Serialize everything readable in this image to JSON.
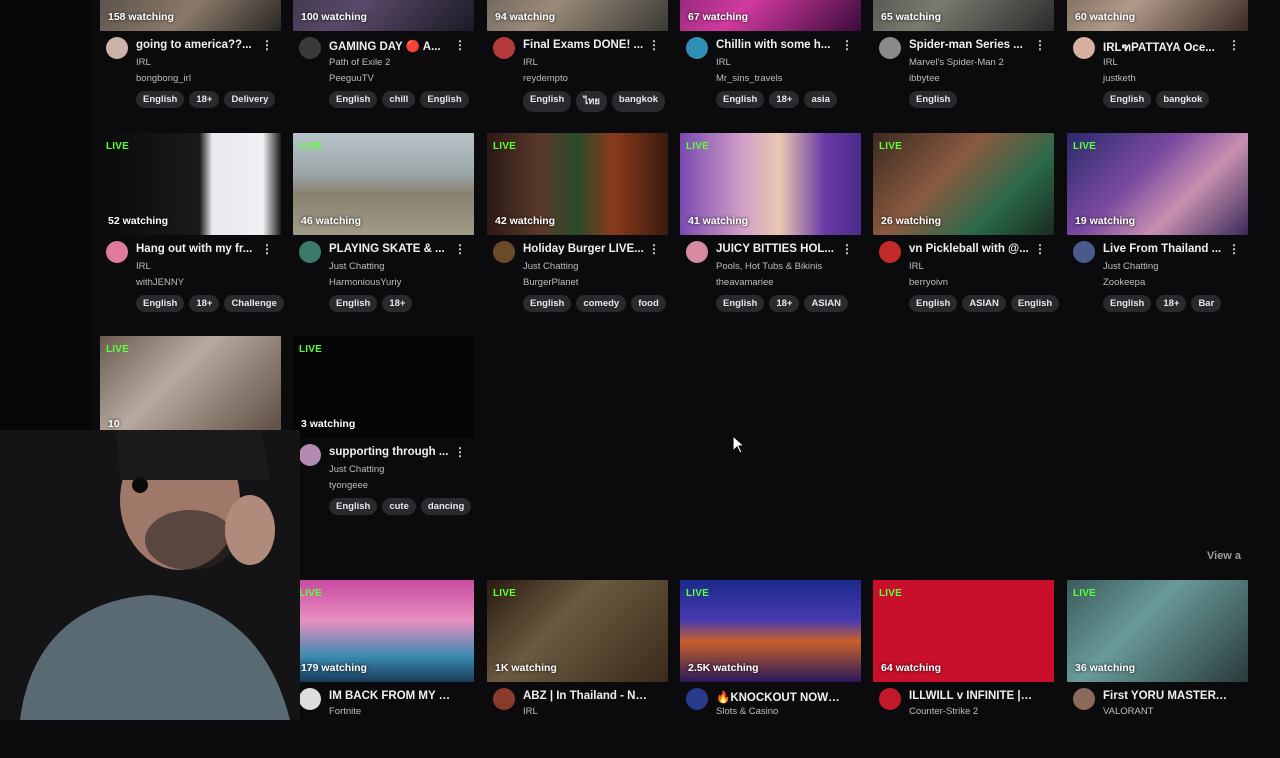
{
  "view_all_label": "View a",
  "streams_row1": [
    {
      "viewers": "158 watching",
      "title": "going to america??...",
      "category": "IRL",
      "channel": "bongbong_irl",
      "tags": [
        "English",
        "18+",
        "Delivery"
      ],
      "avatar_color": "#c9b2a8"
    },
    {
      "viewers": "100 watching",
      "title": "GAMING DAY 🔴 A...",
      "category": "Path of Exile 2",
      "channel": "PeeguuTV",
      "tags": [
        "English",
        "chill",
        "English"
      ],
      "avatar_color": "#2b2b2b"
    },
    {
      "viewers": "94 watching",
      "title": "Final Exams DONE! ...",
      "category": "IRL",
      "channel": "reydempto",
      "tags": [
        "English",
        "ไทย",
        "bangkok"
      ],
      "avatar_color": "#b33a3a"
    },
    {
      "viewers": "67 watching",
      "title": "Chillin with some h...",
      "category": "IRL",
      "channel": "Mr_sins_travels",
      "tags": [
        "English",
        "18+",
        "asia"
      ],
      "avatar_color": "#2f8fb5"
    },
    {
      "viewers": "65 watching",
      "title": "Spider-man Series ...",
      "category": "Marvel's Spider-Man 2",
      "channel": "ibbytee",
      "tags": [
        "English"
      ],
      "avatar_color": "#8a8a8a"
    },
    {
      "viewers": "60 watching",
      "title": "IRLฑPATTAYA Oce...",
      "category": "IRL",
      "channel": "justketh",
      "tags": [
        "English",
        "bangkok"
      ],
      "avatar_color": "#d8b0a0"
    }
  ],
  "streams_row2": [
    {
      "live": "LIVE",
      "viewers": "52 watching",
      "title": "Hang out with my fr...",
      "category": "IRL",
      "channel": "withJENNY",
      "tags": [
        "English",
        "18+",
        "Challenge"
      ],
      "avatar_color": "#e07a9c"
    },
    {
      "live": "LIVE",
      "viewers": "46 watching",
      "title": "PLAYING SKATE & ...",
      "category": "Just Chatting",
      "channel": "HarmoniousYuriy",
      "tags": [
        "English",
        "18+"
      ],
      "avatar_color": "#3a7a6a"
    },
    {
      "live": "LIVE",
      "viewers": "42 watching",
      "title": "Holiday Burger LIVE...",
      "category": "Just Chatting",
      "channel": "BurgerPlanet",
      "tags": [
        "English",
        "comedy",
        "food"
      ],
      "avatar_color": "#6b4a2a"
    },
    {
      "live": "LIVE",
      "viewers": "41 watching",
      "title": "JUICY BITTIES HOL...",
      "category": "Pools, Hot Tubs & Bikinis",
      "channel": "theavamariee",
      "tags": [
        "English",
        "18+",
        "ASIAN"
      ],
      "avatar_color": "#d58aa0"
    },
    {
      "live": "LIVE",
      "viewers": "26 watching",
      "title": "vn Pickleball with @...",
      "category": "IRL",
      "channel": "berryoivn",
      "tags": [
        "English",
        "ASIAN",
        "English"
      ],
      "avatar_color": "#c22a2a"
    },
    {
      "live": "LIVE",
      "viewers": "19 watching",
      "title": "Live From Thailand ...",
      "category": "Just Chatting",
      "channel": "Zookeepa",
      "tags": [
        "English",
        "18+",
        "Bar"
      ],
      "avatar_color": "#4a5a8a"
    }
  ],
  "streams_row3": [
    {
      "live": "LIVE",
      "viewers": "10",
      "title": "",
      "category": "",
      "channel": "",
      "tags": [],
      "avatar_color": "#888"
    },
    {
      "live": "LIVE",
      "viewers": "3 watching",
      "title": "supporting through ...",
      "category": "Just Chatting",
      "channel": "tyongeee",
      "tags": [
        "English",
        "cute",
        "dancing"
      ],
      "avatar_color": "#b58ab0"
    }
  ],
  "streams_row4": [
    {
      "live": "LIVE",
      "viewers": "179 watching",
      "title": "IM BACK FROM MY BIR...",
      "category": "Fortnite",
      "avatar_color": "#ddd"
    },
    {
      "live": "LIVE",
      "viewers": "1K watching",
      "title": "ABZ | In Thailand - Not ...",
      "category": "IRL",
      "avatar_color": "#8a3a2a"
    },
    {
      "live": "LIVE",
      "viewers": "2.5K watching",
      "title": "🔥KNOCKOUT NOW!🔥...",
      "category": "Slots & Casino",
      "avatar_color": "#2a3a8a"
    },
    {
      "live": "LIVE",
      "viewers": "64 watching",
      "title": "ILLWILL v INFINITE | Dr...",
      "category": "Counter-Strike 2",
      "avatar_color": "#c21a2a"
    },
    {
      "live": "LIVE",
      "viewers": "36 watching",
      "title": "First YORU MASTERY a...",
      "category": "VALORANT",
      "avatar_color": "#8a6a5a"
    }
  ]
}
